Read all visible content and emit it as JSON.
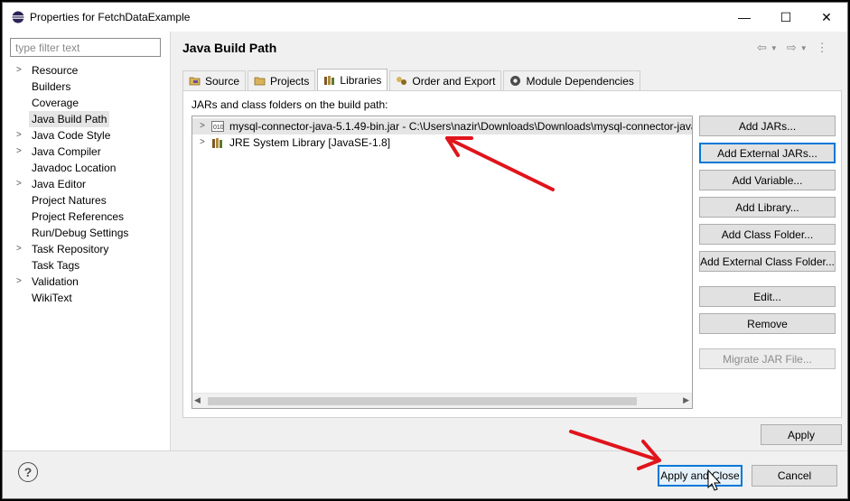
{
  "window": {
    "title": "Properties for FetchDataExample",
    "minimize_glyph": "—",
    "maximize_glyph": "☐",
    "close_glyph": "✕"
  },
  "filter": {
    "placeholder": "type filter text",
    "value": ""
  },
  "nav": {
    "items": [
      {
        "label": "Resource",
        "expandable": true
      },
      {
        "label": "Builders",
        "expandable": false
      },
      {
        "label": "Coverage",
        "expandable": false
      },
      {
        "label": "Java Build Path",
        "expandable": false,
        "selected": true
      },
      {
        "label": "Java Code Style",
        "expandable": true
      },
      {
        "label": "Java Compiler",
        "expandable": true
      },
      {
        "label": "Javadoc Location",
        "expandable": false
      },
      {
        "label": "Java Editor",
        "expandable": true
      },
      {
        "label": "Project Natures",
        "expandable": false
      },
      {
        "label": "Project References",
        "expandable": false
      },
      {
        "label": "Run/Debug Settings",
        "expandable": false
      },
      {
        "label": "Task Repository",
        "expandable": true
      },
      {
        "label": "Task Tags",
        "expandable": false
      },
      {
        "label": "Validation",
        "expandable": true
      },
      {
        "label": "WikiText",
        "expandable": false
      }
    ]
  },
  "page": {
    "title": "Java Build Path"
  },
  "tabs": [
    {
      "label": "Source",
      "icon": "source-folder-icon"
    },
    {
      "label": "Projects",
      "icon": "projects-folder-icon"
    },
    {
      "label": "Libraries",
      "icon": "libraries-icon",
      "active": true
    },
    {
      "label": "Order and Export",
      "icon": "order-export-icon"
    },
    {
      "label": "Module Dependencies",
      "icon": "module-dependencies-icon"
    }
  ],
  "libraries": {
    "label": "JARs and class folders on the build path:",
    "entries": [
      {
        "label": "mysql-connector-java-5.1.49-bin.jar - C:\\Users\\nazir\\Downloads\\Downloads\\mysql-connector-java",
        "icon": "jar-file-icon"
      },
      {
        "label": "JRE System Library [JavaSE-1.8]",
        "icon": "library-icon"
      }
    ],
    "buttons": {
      "add_jars": "Add JARs...",
      "add_external_jars": "Add External JARs...",
      "add_variable": "Add Variable...",
      "add_library": "Add Library...",
      "add_class_folder": "Add Class Folder...",
      "add_external_class_folder": "Add External Class Folder...",
      "edit": "Edit...",
      "remove": "Remove",
      "migrate_jar": "Migrate JAR File..."
    }
  },
  "actions": {
    "apply": "Apply",
    "apply_and_close": "Apply and Close",
    "cancel": "Cancel",
    "help_glyph": "?"
  },
  "colors": {
    "annotation_arrow": "#e0141b",
    "focus_border": "#0078d7"
  }
}
